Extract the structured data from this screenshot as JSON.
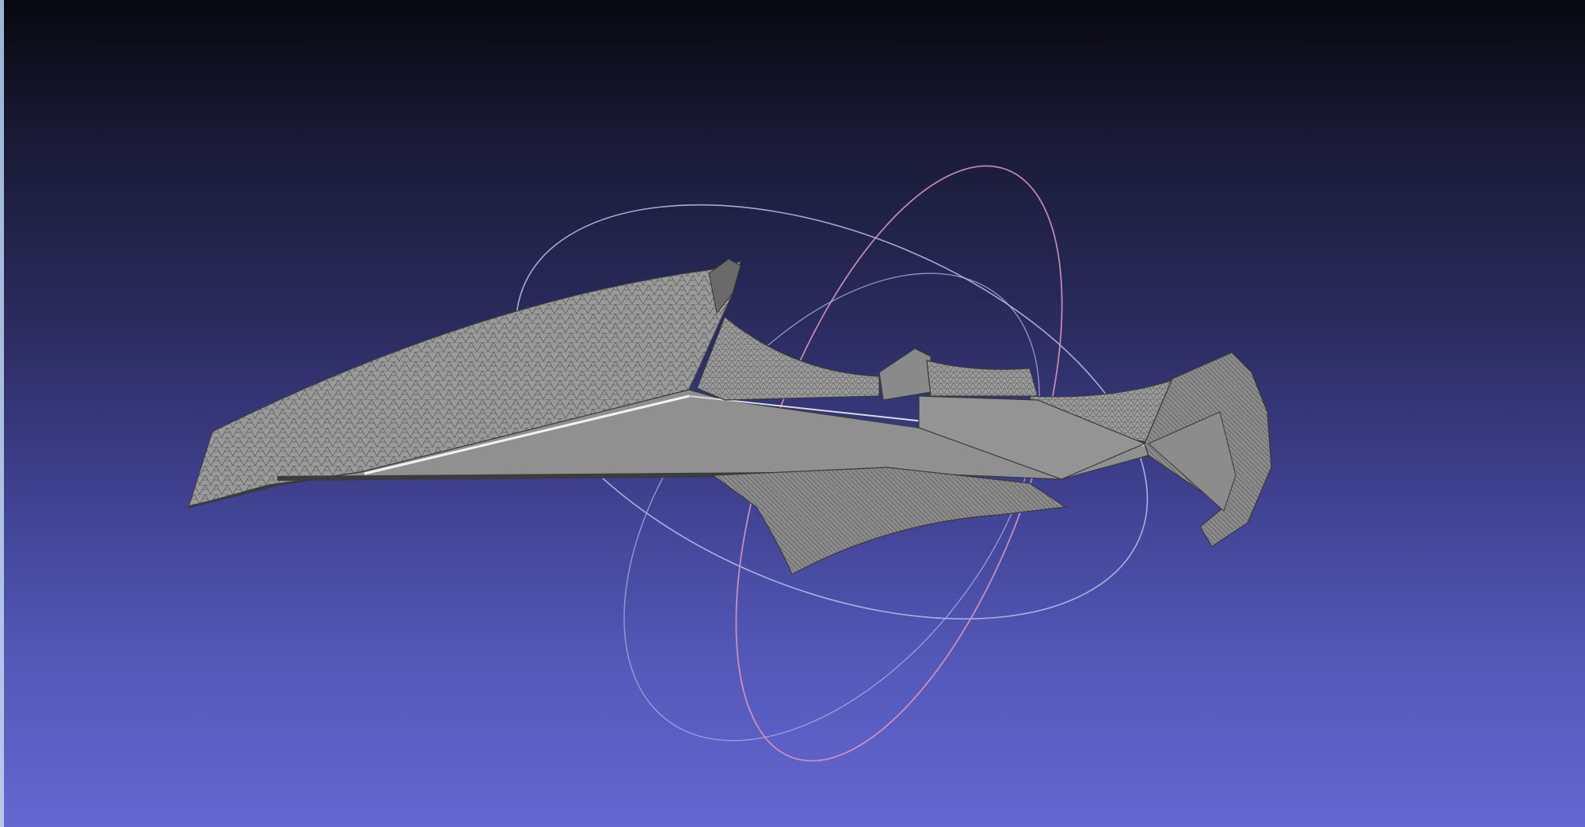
{
  "viewer": {
    "background_top_color": "#08080f",
    "background_bottom_color": "#6467d0",
    "mesh_fill_color": "#8e8e8e",
    "mesh_edge_color": "#3a3a3a",
    "trackball_colors": [
      "#b9c2ea",
      "#d99ac0",
      "#a8b4e0"
    ],
    "window_border_color": "#b7c9e6"
  }
}
